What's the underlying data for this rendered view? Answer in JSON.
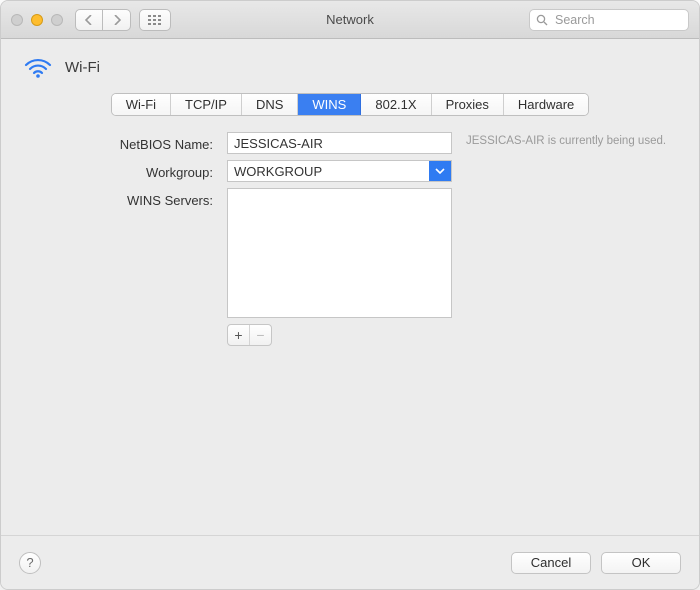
{
  "window": {
    "title": "Network"
  },
  "search": {
    "placeholder": "Search",
    "value": ""
  },
  "header": {
    "interface": "Wi-Fi"
  },
  "tabs": {
    "items": [
      "Wi-Fi",
      "TCP/IP",
      "DNS",
      "WINS",
      "802.1X",
      "Proxies",
      "Hardware"
    ],
    "active_index": 3
  },
  "form": {
    "netbios_label": "NetBIOS Name:",
    "netbios_value": "JESSICAS-AIR",
    "workgroup_label": "Workgroup:",
    "workgroup_value": "WORKGROUP",
    "wins_servers_label": "WINS Servers:",
    "hint": "JESSICAS-AIR is currently being used."
  },
  "footer": {
    "cancel": "Cancel",
    "ok": "OK"
  }
}
